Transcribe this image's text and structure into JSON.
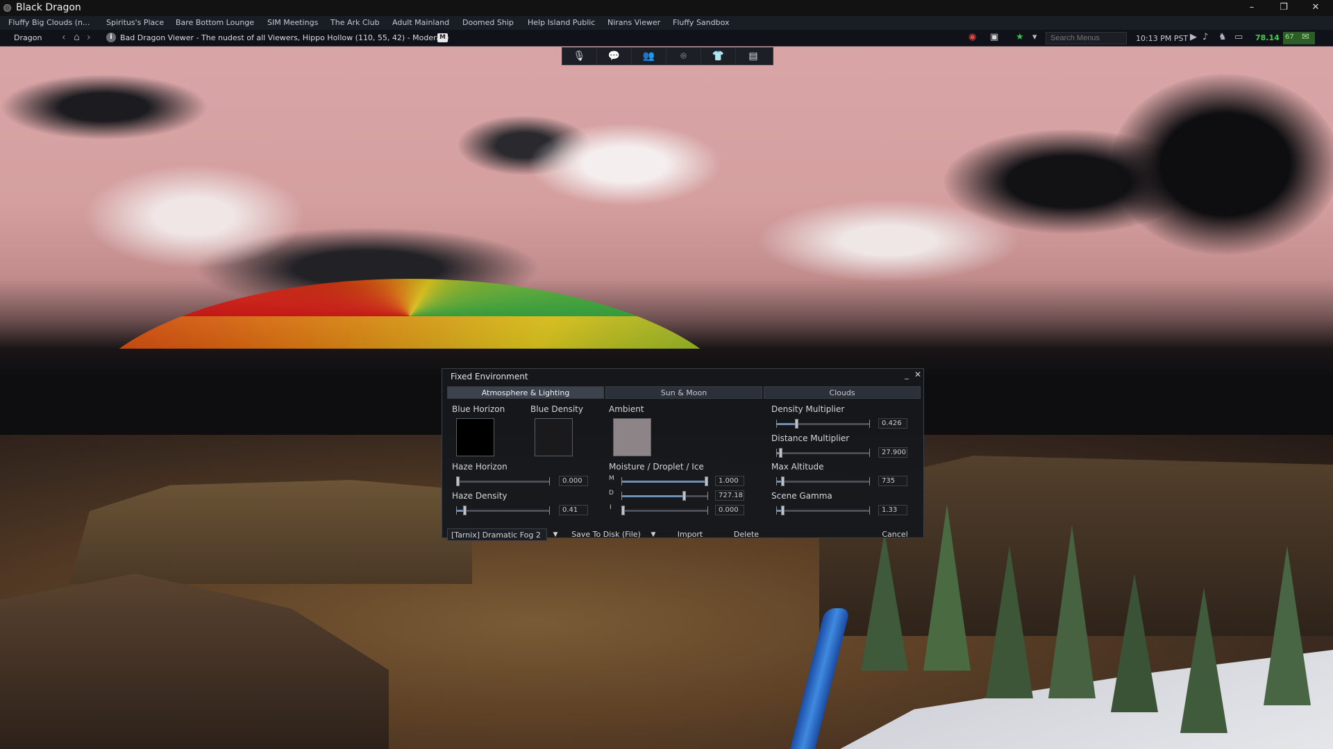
{
  "window": {
    "title": "Black Dragon",
    "controls": {
      "minimize": "–",
      "restore": "❐",
      "close": "✕"
    }
  },
  "favorites": [
    "Fluffy Big Clouds (n...",
    "Spiritus's Place",
    "Bare Bottom Lounge",
    "SIM Meetings",
    "The Ark Club",
    "Adult Mainland",
    "Doomed Ship",
    "Help Island Public",
    "Nirans Viewer",
    "Fluffy Sandbox"
  ],
  "navbar": {
    "name": "Dragon",
    "location": "Bad Dragon Viewer - The nudest of all Viewers, Hippo Hollow (110, 55, 42) - Moderate",
    "maturity": "M",
    "search_placeholder": "Search Menus",
    "clock": "10:13 PM PST",
    "fps": "78.14",
    "bandwidth": "67"
  },
  "toolbar": {
    "icons": [
      "microphone-icon",
      "chat-icon",
      "people-icon",
      "places-icon",
      "appearance-icon",
      "inventory-icon"
    ]
  },
  "floater": {
    "title": "Fixed Environment",
    "tabs": [
      "Atmosphere & Lighting",
      "Sun & Moon",
      "Clouds"
    ],
    "active_tab": "Atmosphere & Lighting",
    "swatches": {
      "blue_horizon": {
        "label": "Blue Horizon",
        "color": "#000000"
      },
      "blue_density": {
        "label": "Blue Density",
        "color": "#1a1a1c"
      },
      "ambient": {
        "label": "Ambient",
        "color": "#8c8487"
      }
    },
    "haze_horizon": {
      "label": "Haze Horizon",
      "value": "0.000",
      "fraction": 0.0
    },
    "haze_density": {
      "label": "Haze Density",
      "value": "0.41",
      "fraction": 0.08
    },
    "moisture": {
      "label": "Moisture / Droplet / Ice",
      "m": {
        "letter": "M",
        "value": "1.000",
        "fraction": 1.0
      },
      "d": {
        "letter": "D",
        "value": "727.18",
        "fraction": 0.73
      },
      "i": {
        "letter": "I",
        "value": "0.000",
        "fraction": 0.0
      }
    },
    "density_multiplier": {
      "label": "Density Multiplier",
      "value": "0.426",
      "fraction": 0.21
    },
    "distance_multiplier": {
      "label": "Distance Multiplier",
      "value": "27.900",
      "fraction": 0.03
    },
    "max_altitude": {
      "label": "Max Altitude",
      "value": "735",
      "fraction": 0.05
    },
    "scene_gamma": {
      "label": "Scene Gamma",
      "value": "1.33",
      "fraction": 0.05
    },
    "preset": "[Tarnix] Dramatic Fog 2",
    "buttons": {
      "save": "Save To Disk (File)",
      "import": "Import",
      "delete": "Delete",
      "cancel": "Cancel"
    }
  },
  "colors": {
    "sky_pink": "#d8a5a7",
    "fps_green": "#3fd14a",
    "bandwidth_bg": "#2d5e28"
  }
}
